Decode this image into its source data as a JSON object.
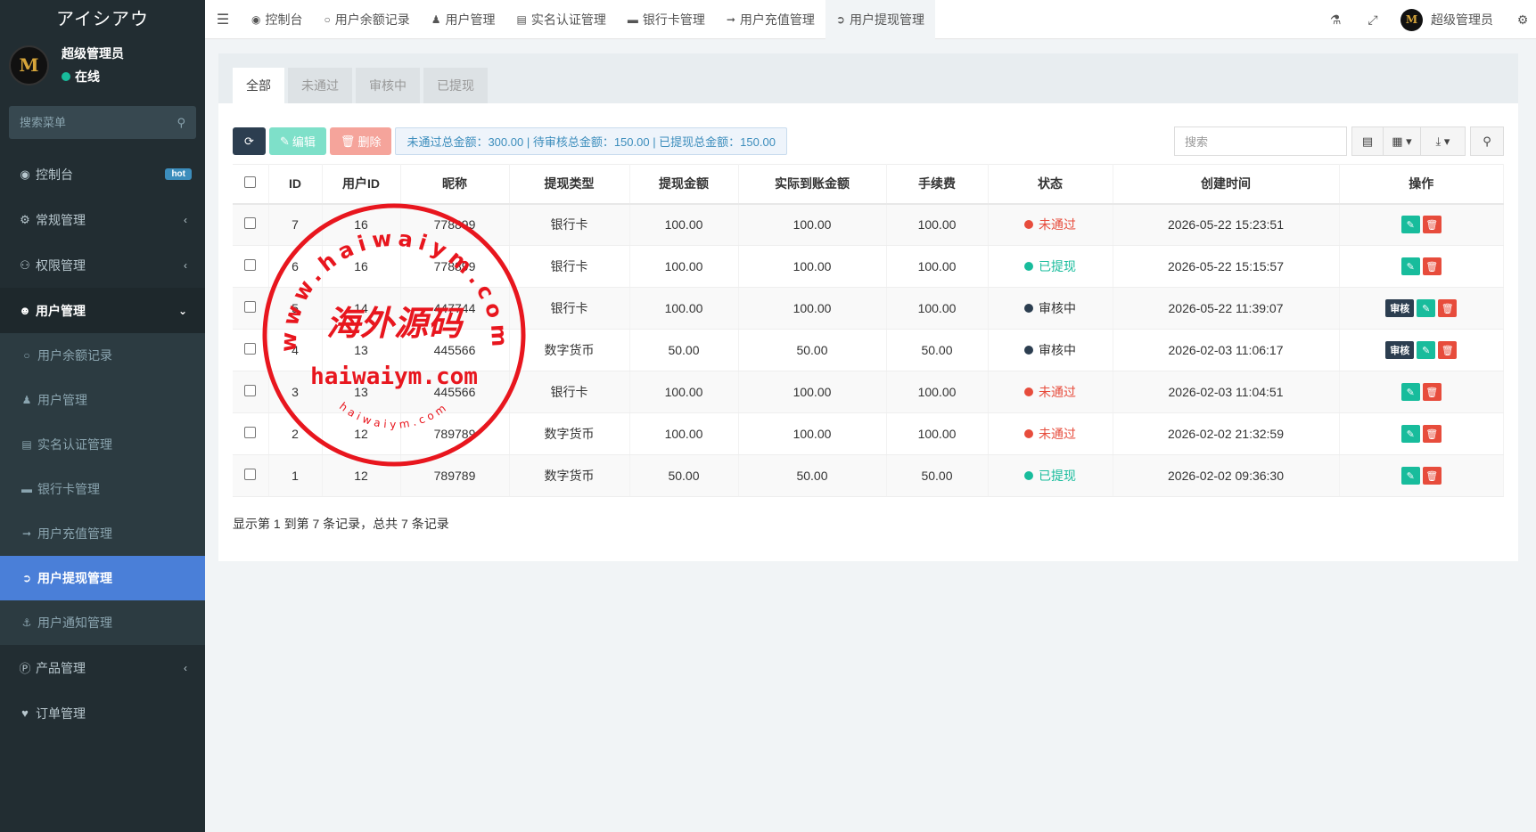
{
  "app": {
    "title": "アイシアウ",
    "user_name": "超级管理员",
    "user_status": "在线",
    "search_placeholder": "搜索菜单"
  },
  "sidebar": {
    "items": [
      {
        "label": "控制台",
        "icon": "dashboard-icon",
        "badge": "hot"
      },
      {
        "label": "常规管理",
        "icon": "cogs-icon"
      },
      {
        "label": "权限管理",
        "icon": "group-icon"
      },
      {
        "label": "用户管理",
        "icon": "user-circle-icon"
      },
      {
        "label": "产品管理",
        "icon": "product-hunt-icon"
      },
      {
        "label": "订单管理",
        "icon": "heartbeat-icon"
      }
    ],
    "sub_items": [
      {
        "label": "用户余额记录",
        "icon": "circle-o-icon"
      },
      {
        "label": "用户管理",
        "icon": "user-icon"
      },
      {
        "label": "实名认证管理",
        "icon": "id-card-icon"
      },
      {
        "label": "银行卡管理",
        "icon": "credit-card-icon"
      },
      {
        "label": "用户充值管理",
        "icon": "sign-in-icon"
      },
      {
        "label": "用户提现管理",
        "icon": "sign-out-icon"
      },
      {
        "label": "用户通知管理",
        "icon": "anchor-icon"
      }
    ]
  },
  "navbar": {
    "tabs": [
      {
        "label": "控制台",
        "icon": "dashboard-icon"
      },
      {
        "label": "用户余额记录",
        "icon": "circle-o-icon"
      },
      {
        "label": "用户管理",
        "icon": "user-icon"
      },
      {
        "label": "实名认证管理",
        "icon": "id-card-icon"
      },
      {
        "label": "银行卡管理",
        "icon": "credit-card-icon"
      },
      {
        "label": "用户充值管理",
        "icon": "sign-in-icon"
      },
      {
        "label": "用户提现管理",
        "icon": "sign-out-icon"
      }
    ],
    "user_name": "超级管理员"
  },
  "panel": {
    "tabs": [
      "全部",
      "未通过",
      "审核中",
      "已提现"
    ],
    "toolbar": {
      "edit_label": "编辑",
      "delete_label": "删除",
      "summary": "未通过总金额：300.00 | 待审核总金额：150.00 | 已提现总金额：150.00",
      "search_placeholder": "搜索"
    },
    "columns": [
      "ID",
      "用户ID",
      "昵称",
      "提现类型",
      "提现金额",
      "实际到账金额",
      "手续费",
      "状态",
      "创建时间",
      "操作"
    ],
    "rows": [
      {
        "id": "7",
        "user_id": "16",
        "nickname": "778899",
        "type": "银行卡",
        "amount": "100.00",
        "actual": "100.00",
        "fee": "100.00",
        "status": "未通过",
        "status_kind": "red",
        "created": "2026-05-22 15:23:51",
        "review": false
      },
      {
        "id": "6",
        "user_id": "16",
        "nickname": "778899",
        "type": "银行卡",
        "amount": "100.00",
        "actual": "100.00",
        "fee": "100.00",
        "status": "已提现",
        "status_kind": "green",
        "created": "2026-05-22 15:15:57",
        "review": false
      },
      {
        "id": "5",
        "user_id": "14",
        "nickname": "447744",
        "type": "银行卡",
        "amount": "100.00",
        "actual": "100.00",
        "fee": "100.00",
        "status": "审核中",
        "status_kind": "dark",
        "created": "2026-05-22 11:39:07",
        "review": true
      },
      {
        "id": "4",
        "user_id": "13",
        "nickname": "445566",
        "type": "数字货币",
        "amount": "50.00",
        "actual": "50.00",
        "fee": "50.00",
        "status": "审核中",
        "status_kind": "dark",
        "created": "2026-02-03 11:06:17",
        "review": true
      },
      {
        "id": "3",
        "user_id": "13",
        "nickname": "445566",
        "type": "银行卡",
        "amount": "100.00",
        "actual": "100.00",
        "fee": "100.00",
        "status": "未通过",
        "status_kind": "red",
        "created": "2026-02-03 11:04:51",
        "review": false
      },
      {
        "id": "2",
        "user_id": "12",
        "nickname": "789789",
        "type": "数字货币",
        "amount": "100.00",
        "actual": "100.00",
        "fee": "100.00",
        "status": "未通过",
        "status_kind": "red",
        "created": "2026-02-02 21:32:59",
        "review": false
      },
      {
        "id": "1",
        "user_id": "12",
        "nickname": "789789",
        "type": "数字货币",
        "amount": "50.00",
        "actual": "50.00",
        "fee": "50.00",
        "status": "已提现",
        "status_kind": "green",
        "created": "2026-02-02 09:36:30",
        "review": false
      }
    ],
    "review_label": "审核",
    "pagination": "显示第 1 到第 7 条记录，总共 7 条记录"
  },
  "watermark": {
    "top_arc": "www.haiwaiym.com",
    "center": "海外源码",
    "middle": "haiwaiym.com",
    "bottom_arc": "haiwaiym.com",
    "color": "#e8161e"
  }
}
